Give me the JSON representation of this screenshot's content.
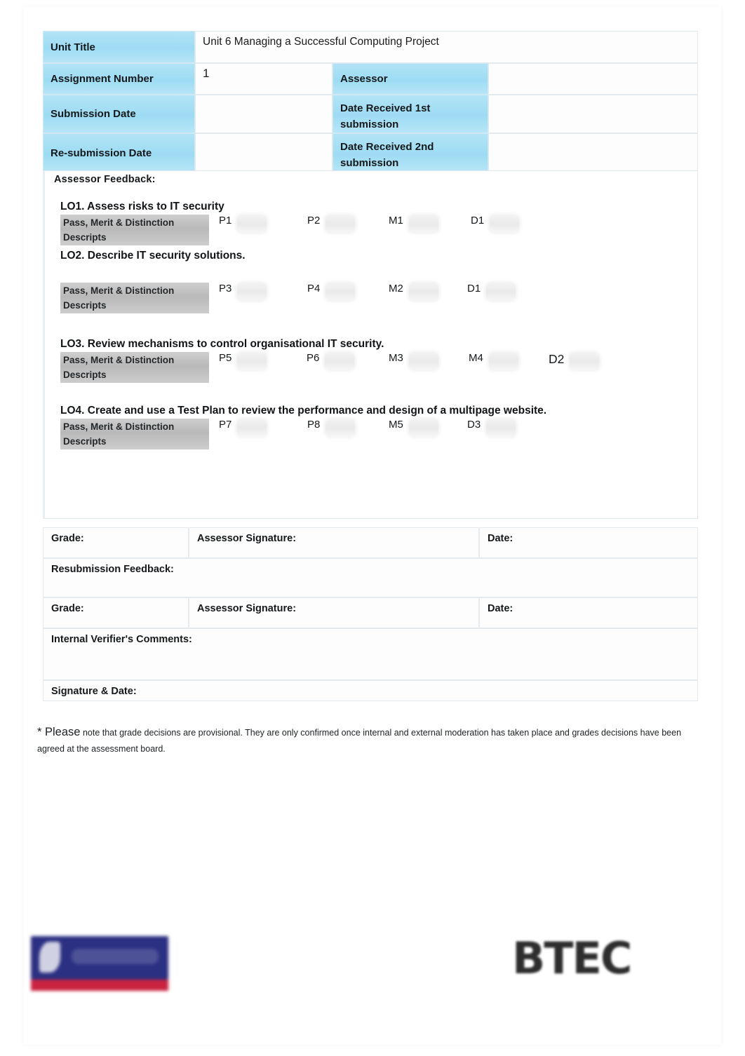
{
  "header": {
    "rows": [
      {
        "label": "Unit Title",
        "value": "Unit 6 Managing a Successful Computing Project"
      },
      {
        "label": "Assignment  Number",
        "value": "1",
        "label2": "Assessor",
        "value2": ""
      },
      {
        "label": "Submission Date",
        "value": "",
        "label2": "Date Received  1st submission",
        "value2": ""
      },
      {
        "label": "Re-submission Date",
        "value": "",
        "label2": "Date Received  2nd submission",
        "value2": ""
      }
    ],
    "unit_title_label": "Unit Title",
    "unit_title_value": "Unit 6 Managing a Successful Computing Project",
    "assignment_number_label": "Assignment  Number",
    "assignment_number_value": "1",
    "assessor_label": "Assessor",
    "assessor_value": "",
    "submission_date_label": "Submission Date",
    "submission_date_value": "",
    "date_received_1_label": "Date Received  1st submission",
    "date_received_1_value": "",
    "resubmission_date_label": "Re-submission Date",
    "resubmission_date_value": "",
    "date_received_2_label": "Date Received  2nd submission",
    "date_received_2_value": ""
  },
  "feedback": {
    "title": "Assessor  Feedback:",
    "descriptor_label": "Pass, Merit & Distinction Descripts",
    "learning_outcomes": [
      {
        "heading": "LO1. Assess risks to IT security",
        "criteria": [
          "P1",
          "P2",
          "M1",
          "D1"
        ]
      },
      {
        "heading": "LO2. Describe IT security solutions.",
        "criteria": [
          "P3",
          "P4",
          "M2",
          "D1"
        ]
      },
      {
        "heading": "LO3. Review mechanisms to control organisational IT security.",
        "criteria": [
          "P5",
          "P6",
          "M3",
          "M4",
          "D2"
        ]
      },
      {
        "heading": "LO4. Create and use a Test Plan to review the performance and design of a multipage website.",
        "criteria": [
          "P7",
          "P8",
          "M5",
          "D3"
        ]
      }
    ]
  },
  "signoff": {
    "grade_label": "Grade:",
    "assessor_signature_label": "Assessor Signature:",
    "date_label": "Date:",
    "resubmission_feedback_label": "Resubmission Feedback:",
    "grade_label_2": "Grade:",
    "assessor_signature_label_2": "Assessor Signature:",
    "date_label_2": "Date:",
    "internal_verifier_label": "Internal Verifier's Comments:",
    "signature_date_label": "Signature & Date:"
  },
  "footnote": {
    "lead": "* Please",
    "rest": " note that grade decisions are provisional. They are only confirmed once internal and external moderation has taken place and grades decisions have been agreed at the assessment board."
  },
  "logos": {
    "left_logo_name": "institution-logo",
    "btec_text": "BTEC"
  },
  "colors": {
    "header_blue": "#9ddcf3",
    "descriptor_grey": "#b9b9b9",
    "logo_navy": "#2c3082",
    "logo_red": "#c9233f"
  }
}
